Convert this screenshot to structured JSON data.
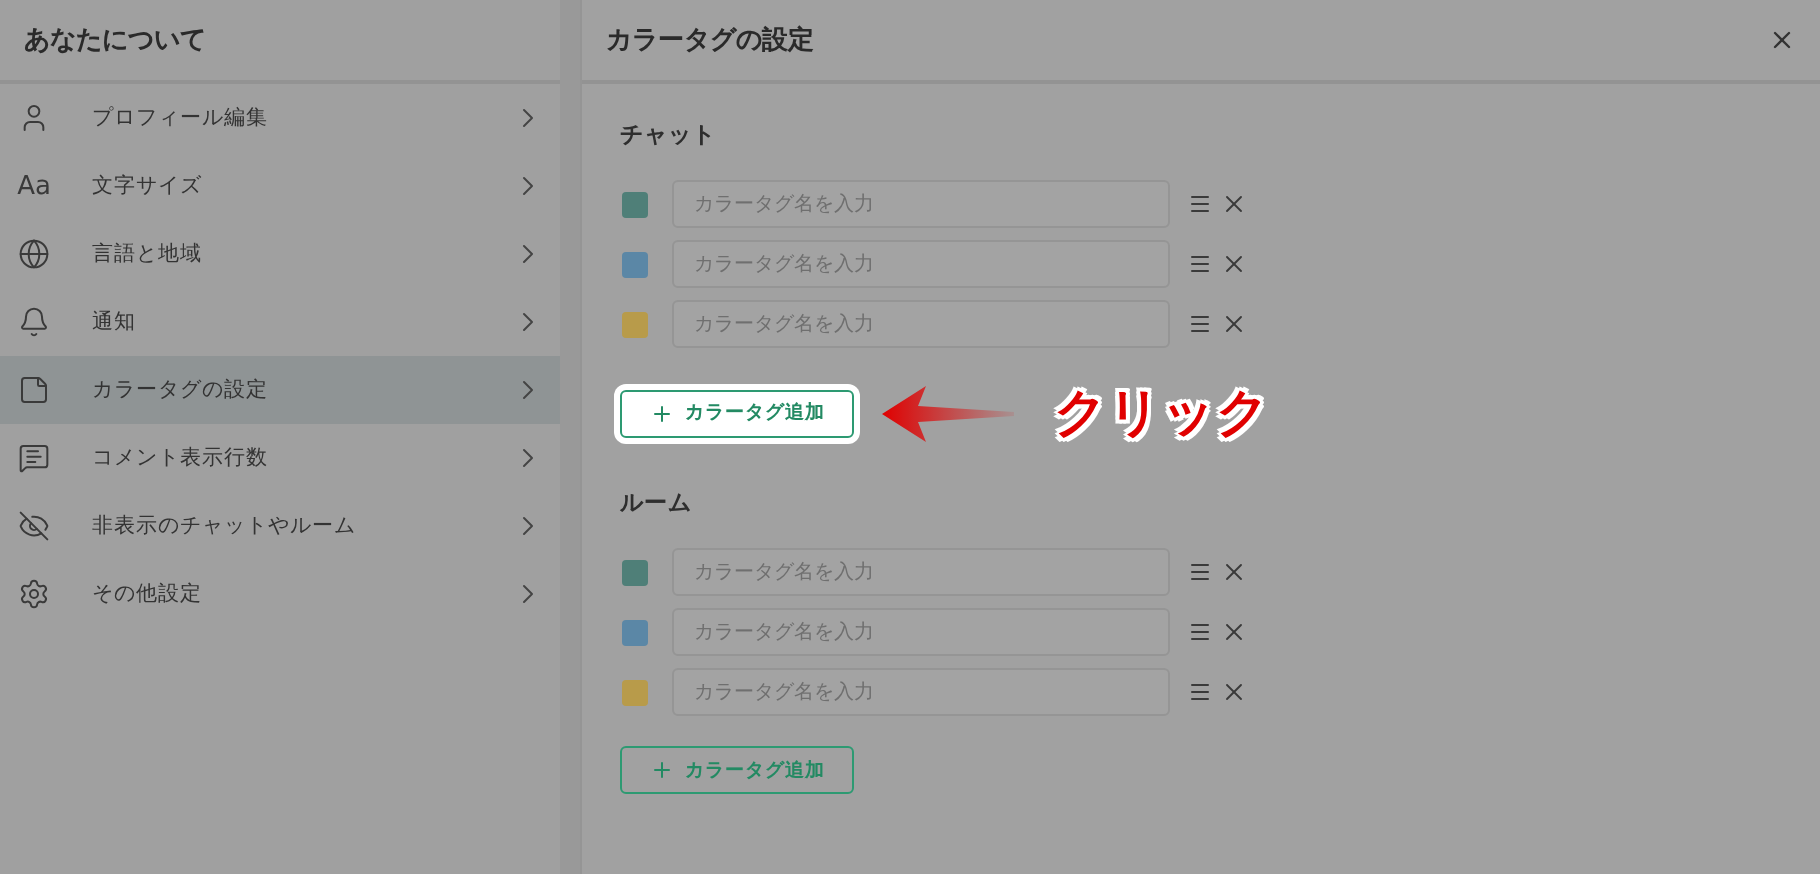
{
  "sidebar": {
    "title": "あなたについて",
    "items": [
      {
        "label": "プロフィール編集",
        "selected": false
      },
      {
        "glyph": "Aa",
        "label": "文字サイズ",
        "selected": false
      },
      {
        "label": "言語と地域",
        "selected": false
      },
      {
        "label": "通知",
        "selected": false
      },
      {
        "label": "カラータグの設定",
        "selected": true
      },
      {
        "label": "コメント表示行数",
        "selected": false
      },
      {
        "label": "非表示のチャットやルーム",
        "selected": false
      },
      {
        "label": "その他設定",
        "selected": false
      }
    ]
  },
  "panel": {
    "title": "カラータグの設定",
    "sections": [
      {
        "title": "チャット",
        "tags": [
          {
            "color": "#4f7f78",
            "placeholder": "カラータグ名を入力"
          },
          {
            "color": "#5b87a6",
            "placeholder": "カラータグ名を入力"
          },
          {
            "color": "#b89b4a",
            "placeholder": "カラータグ名を入力"
          }
        ],
        "add_button": {
          "label": "カラータグ追加",
          "highlighted": true
        }
      },
      {
        "title": "ルーム",
        "tags": [
          {
            "color": "#4f7f78",
            "placeholder": "カラータグ名を入力"
          },
          {
            "color": "#5b87a6",
            "placeholder": "カラータグ名を入力"
          },
          {
            "color": "#b89b4a",
            "placeholder": "カラータグ名を入力"
          }
        ],
        "add_button": {
          "label": "カラータグ追加",
          "highlighted": false
        }
      }
    ]
  },
  "annotation": {
    "label": "クリック"
  }
}
